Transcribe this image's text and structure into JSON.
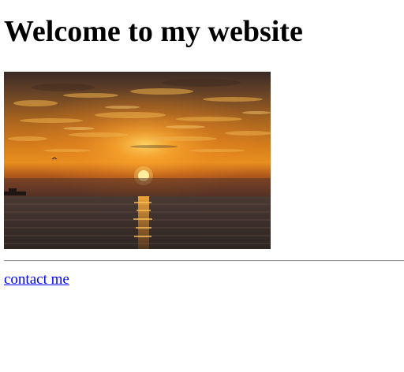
{
  "page": {
    "heading": "Welcome to my website",
    "image": {
      "subject": "sunset-over-sea-photo"
    },
    "link": {
      "label": "contact me",
      "color": "#0000ee"
    }
  }
}
